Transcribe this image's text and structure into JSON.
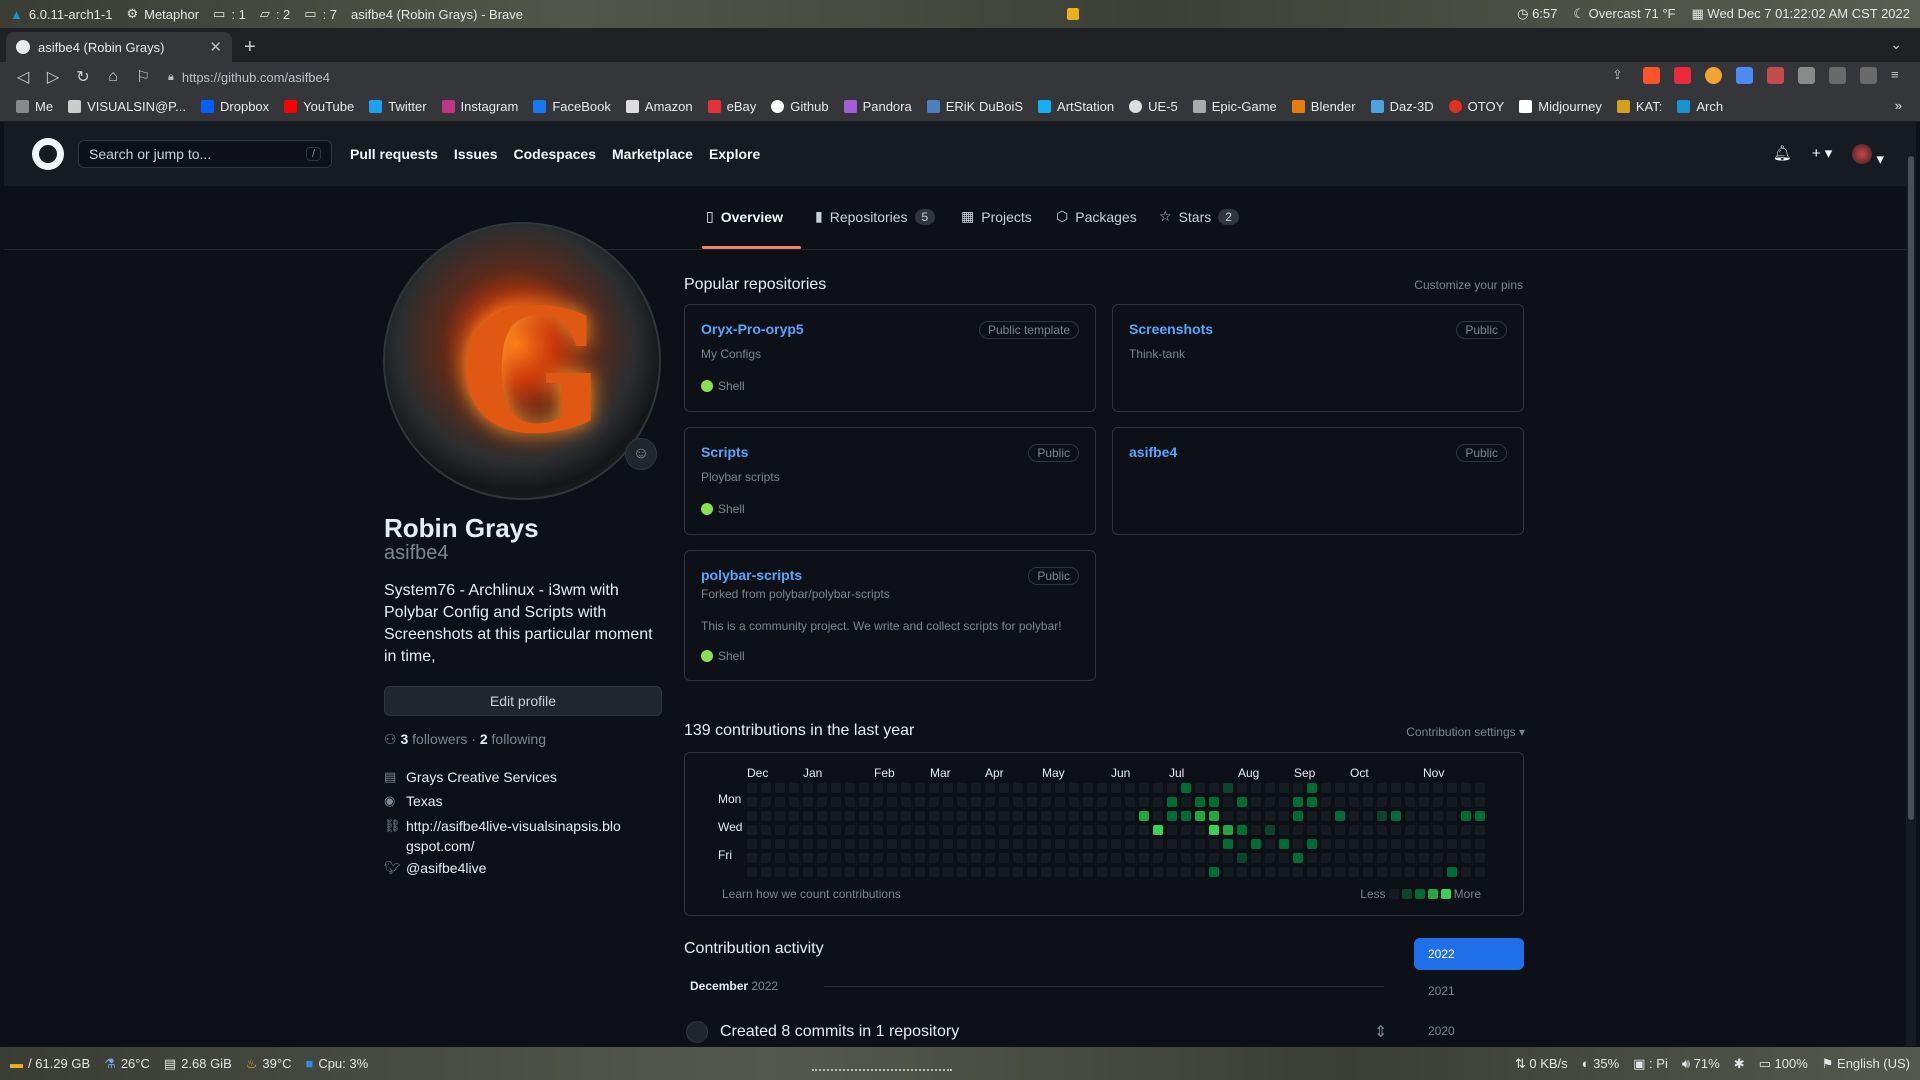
{
  "topbar": {
    "kernel": "6.0.11-arch1-1",
    "theme": "Metaphor",
    "counter1": ": 1",
    "counter2": ": 2",
    "counter3": ": 7",
    "window_title": "asifbe4 (Robin Grays) - Brave",
    "uptime": "6:57",
    "weather": "Overcast 71 °F",
    "datetime": "Wed Dec  7 01:22:02 AM CST 2022"
  },
  "browser": {
    "tab_title": "asifbe4 (Robin Grays)",
    "url": "https://github.com/asifbe4"
  },
  "bookmarks": [
    {
      "label": "Me",
      "color": "#888888"
    },
    {
      "label": "VISUALSIN@P...",
      "color": "#cccccc"
    },
    {
      "label": "Dropbox",
      "color": "#0061ff"
    },
    {
      "label": "YouTube",
      "color": "#ff0000"
    },
    {
      "label": "Twitter",
      "color": "#1da1f2"
    },
    {
      "label": "Instagram",
      "color": "#c13584"
    },
    {
      "label": "FaceBook",
      "color": "#1877f2"
    },
    {
      "label": "Amazon",
      "color": "#dddddd"
    },
    {
      "label": "eBay",
      "color": "#e53238"
    },
    {
      "label": "Github",
      "color": "#ffffff"
    },
    {
      "label": "Pandora",
      "color": "#a35dd9"
    },
    {
      "label": "ERiK DuBoiS",
      "color": "#4d7ebf"
    },
    {
      "label": "ArtStation",
      "color": "#13aff0"
    },
    {
      "label": "UE-5",
      "color": "#dddddd"
    },
    {
      "label": "Epic-Game",
      "color": "#aaaaaa"
    },
    {
      "label": "Blender",
      "color": "#e87d0d"
    },
    {
      "label": "Daz-3D",
      "color": "#4aa3df"
    },
    {
      "label": "OTOY",
      "color": "#e0301e"
    },
    {
      "label": "Midjourney",
      "color": "#ffffff"
    },
    {
      "label": "KAT:",
      "color": "#d4a21a"
    },
    {
      "label": "Arch",
      "color": "#1793d1"
    }
  ],
  "github": {
    "search_placeholder": "Search or jump to...",
    "search_key": "/",
    "nav": [
      "Pull requests",
      "Issues",
      "Codespaces",
      "Marketplace",
      "Explore"
    ],
    "tabs": {
      "overview": "Overview",
      "repositories": "Repositories",
      "repositories_count": "5",
      "projects": "Projects",
      "packages": "Packages",
      "stars": "Stars",
      "stars_count": "2"
    }
  },
  "profile": {
    "name": "Robin Grays",
    "login": "asifbe4",
    "bio": "System76 - Archlinux - i3wm with Polybar Config and Scripts with Screenshots at this particular moment in time,",
    "edit_label": "Edit profile",
    "followers": "3",
    "followers_label": "followers",
    "following": "2",
    "following_label": "following",
    "company": "Grays Creative Services",
    "location": "Texas",
    "website": "http://asifbe4live-visualsinapsis.blogspot.com/",
    "twitter": "@asifbe4live"
  },
  "popular": {
    "title": "Popular repositories",
    "customize": "Customize your pins",
    "repos": [
      {
        "name": "Oryx-Pro-oryp5",
        "visibility": "Public template",
        "desc": "My Configs",
        "lang": "Shell"
      },
      {
        "name": "Screenshots",
        "visibility": "Public",
        "desc": "Think-tank",
        "lang": ""
      },
      {
        "name": "Scripts",
        "visibility": "Public",
        "desc": "Ploybar scripts",
        "lang": "Shell"
      },
      {
        "name": "asifbe4",
        "visibility": "Public",
        "desc": "",
        "lang": ""
      },
      {
        "name": "polybar-scripts",
        "visibility": "Public",
        "forked": "Forked from polybar/polybar-scripts",
        "desc": "This is a community project. We write and collect scripts for polybar!",
        "lang": "Shell"
      }
    ]
  },
  "contributions": {
    "title": "139 contributions in the last year",
    "settings": "Contribution settings ▾",
    "months": [
      "Dec",
      "Jan",
      "Feb",
      "Mar",
      "Apr",
      "May",
      "Jun",
      "Jul",
      "Aug",
      "Sep",
      "Oct",
      "Nov"
    ],
    "days": [
      "Mon",
      "Wed",
      "Fri"
    ],
    "learn": "Learn how we count contributions",
    "less": "Less",
    "more": "More",
    "colors": [
      "#161b22",
      "#0e4429",
      "#006d32",
      "#26a641",
      "#39d353"
    ]
  },
  "activity": {
    "title": "Contribution activity",
    "years": [
      "2022",
      "2021",
      "2020"
    ],
    "month": "December",
    "year": "2022",
    "item": "Created 8 commits in 1 repository"
  },
  "statusbar": {
    "disk": "/ 61.29 GB",
    "temp1": "26°C",
    "mem": "2.68 GiB",
    "temp2": "39°C",
    "cpu": "Cpu: 3%",
    "net": "0 KB/s",
    "brightness": "35%",
    "pi": "Pi",
    "volume": "71%",
    "battery": "100%",
    "lang": "English (US)"
  }
}
